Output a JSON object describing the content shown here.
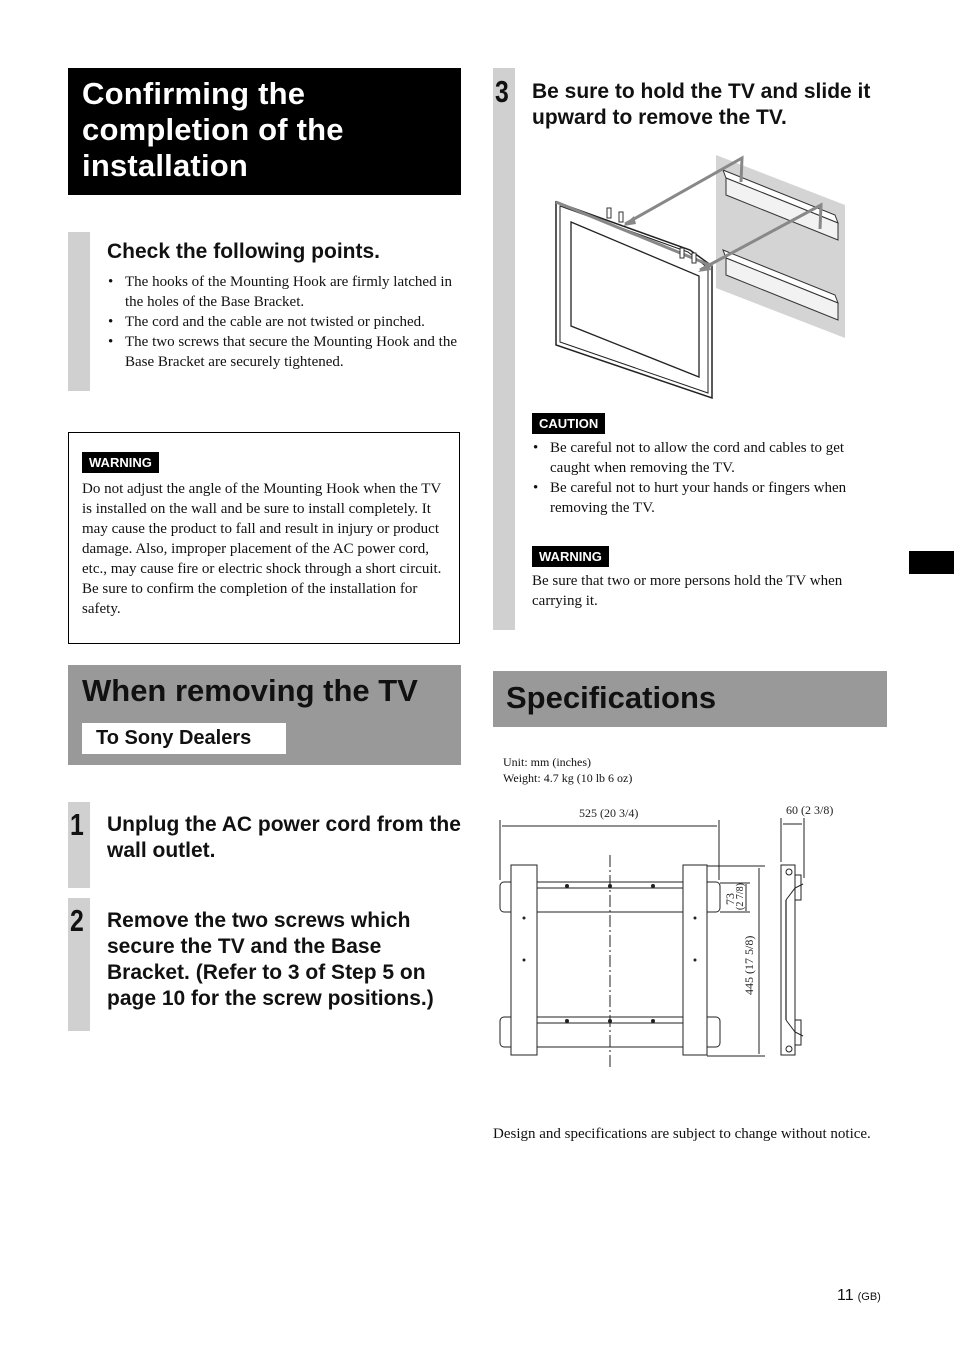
{
  "left_column": {
    "confirm_title": [
      "Confirming the",
      "completion of the",
      "installation"
    ],
    "check_heading": "Check the following points.",
    "check_items": [
      "The hooks of the Mounting Hook are firmly latched in the holes of the Base Bracket.",
      "The cord and the cable are not twisted or pinched.",
      "The two screws that secure the Mounting Hook and the Base Bracket are securely tightened."
    ],
    "warning": {
      "label": "WARNING",
      "text": "Do not adjust the angle of the Mounting Hook when the TV is installed on the wall and be sure to install completely. It may cause the product to fall and result in injury or product damage. Also, improper placement of the AC power cord, etc., may cause fire or electric shock through a short circuit.",
      "text2": "Be sure to confirm the completion of the installation for safety."
    },
    "remove_title": "When removing the TV",
    "remove_subtitle": "To Sony Dealers",
    "steps": [
      {
        "num": "1",
        "text": "Unplug the AC power cord from the wall outlet."
      },
      {
        "num": "2",
        "text": "Remove the two screws which secure the TV and the Base Bracket. (Refer to 3 of Step 5 on page 10 for the screw positions.)"
      }
    ]
  },
  "right_column": {
    "step3": {
      "num": "3",
      "text": "Be sure to hold the TV and slide it upward to remove the TV."
    },
    "illustration": "tv-removal-diagram",
    "caution": {
      "label": "CAUTION",
      "items": [
        "Be careful not to allow the cord and cables to get caught when removing the TV.",
        "Be careful not to hurt your hands or fingers when removing the TV."
      ]
    },
    "warning": {
      "label": "WARNING",
      "text": "Be sure that two or more persons hold the TV when carrying it."
    },
    "specs_title": "Specifications",
    "unit": "Unit: mm (inches)",
    "weight": "Weight: 4.7 kg (10 lb 6 oz)",
    "dimensions": {
      "width": "525 (20 3/4)",
      "depth": "60 (2 3/8)",
      "rail_height": "73",
      "rail_height_in": "(2 7/8)",
      "height": "445 (17 5/8)"
    },
    "disclaimer": "Design and specifications are subject to change without notice."
  },
  "footer": {
    "page_number": "11",
    "region": "(GB)"
  }
}
